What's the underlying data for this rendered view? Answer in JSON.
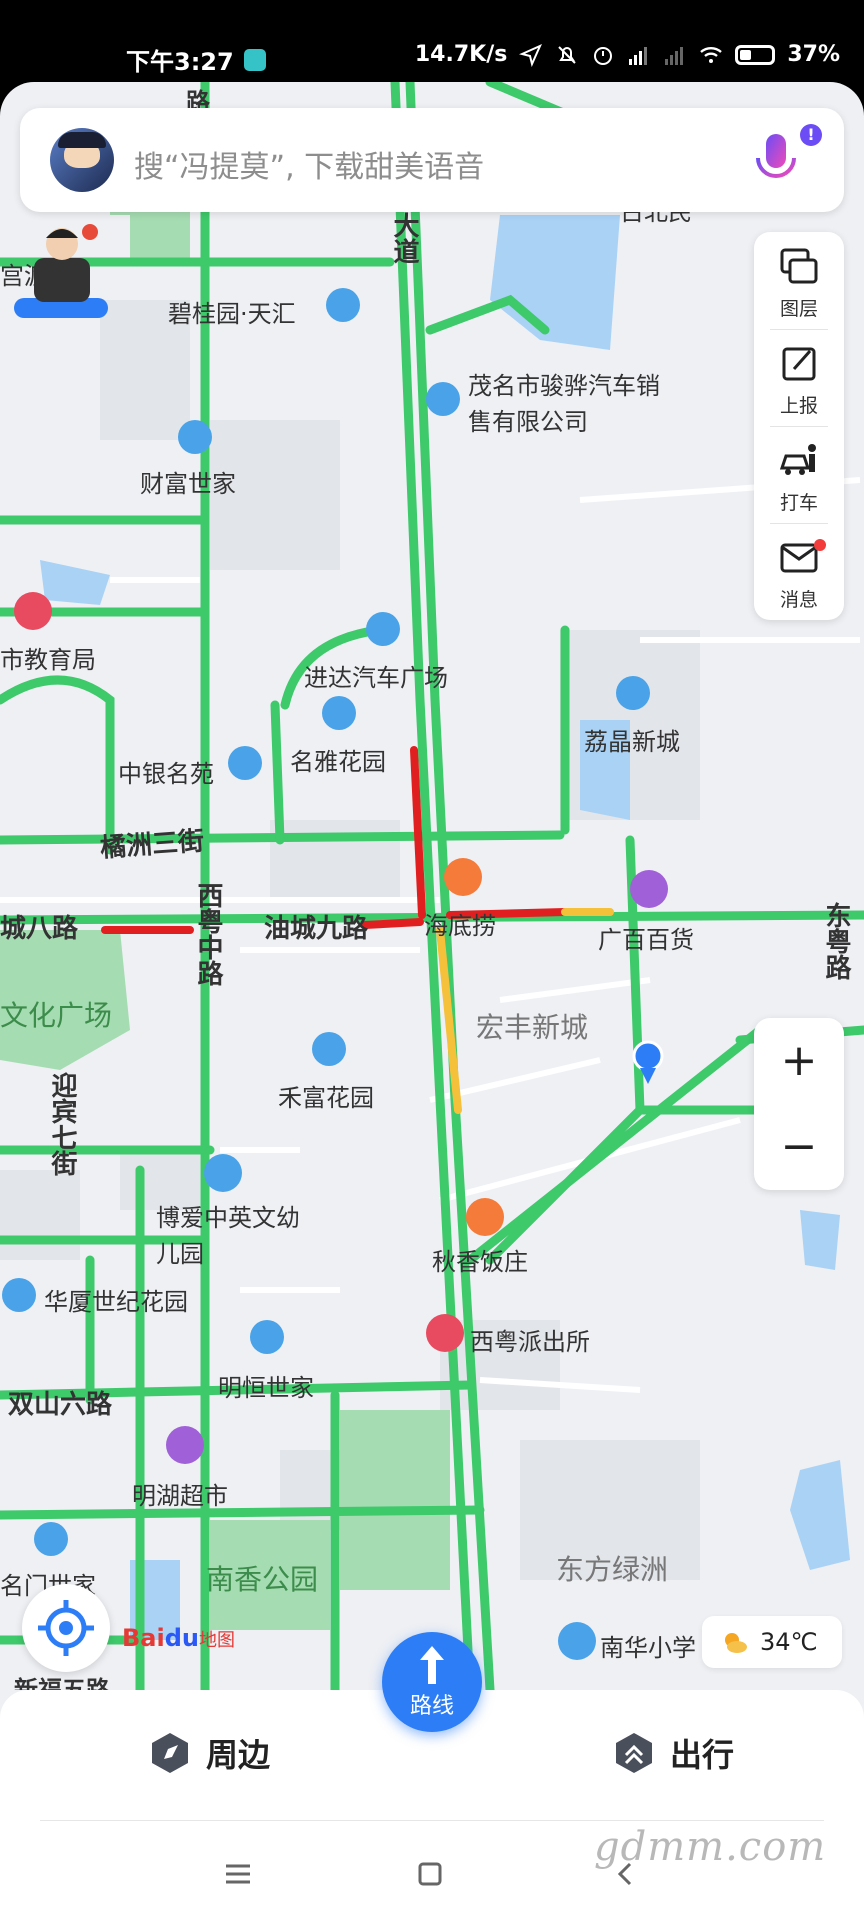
{
  "status_bar": {
    "time": "下午3:27",
    "network_speed": "14.7K/s",
    "battery": "37%"
  },
  "search": {
    "placeholder": "搜“冯提莫”, 下载甜美语音",
    "mic_badge": "!"
  },
  "toolbar": [
    {
      "icon": "layers-icon",
      "label": "图层"
    },
    {
      "icon": "report-icon",
      "label": "上报"
    },
    {
      "icon": "taxi-icon",
      "label": "打车"
    },
    {
      "icon": "message-icon",
      "label": "消息"
    }
  ],
  "zoom": {
    "in": "+",
    "out": "−"
  },
  "map": {
    "roads": [
      "大道",
      "路",
      "橘洲三街",
      "油城九路",
      "城八路",
      "西粤中路",
      "东粤路",
      "迎宾七街",
      "双山六路",
      "新福五路"
    ],
    "places": [
      "碧桂园·天汇",
      "茂名市骏骅汽车销售有限公司",
      "财富世家",
      "市教育局",
      "进达汽车广场",
      "中银名苑",
      "名雅花园",
      "荔晶新城",
      "海底捞",
      "广百百货",
      "文化广场",
      "宏丰新城",
      "禾富花园",
      "博爱中英文幼儿园",
      "秋香饭庄",
      "华厦世纪花园",
      "西粤派出所",
      "明恒世家",
      "明湖超市",
      "南香公园",
      "东方绿洲",
      "南华小学",
      "名门世家",
      "宫渡",
      "古北民"
    ]
  },
  "brand": {
    "bai": "Bai",
    "du": "du",
    "sub": "地图"
  },
  "weather": {
    "temp": "34℃"
  },
  "bottom_bar": {
    "nearby": "周边",
    "route": "路线",
    "travel": "出行"
  },
  "watermark": "gdmm.com",
  "colors": {
    "road_green": "#3ec96b",
    "road_red": "#e02020",
    "road_yellow": "#f5c13b",
    "accent_blue": "#2d7ef6",
    "poi_blue": "#4aa3e8"
  }
}
